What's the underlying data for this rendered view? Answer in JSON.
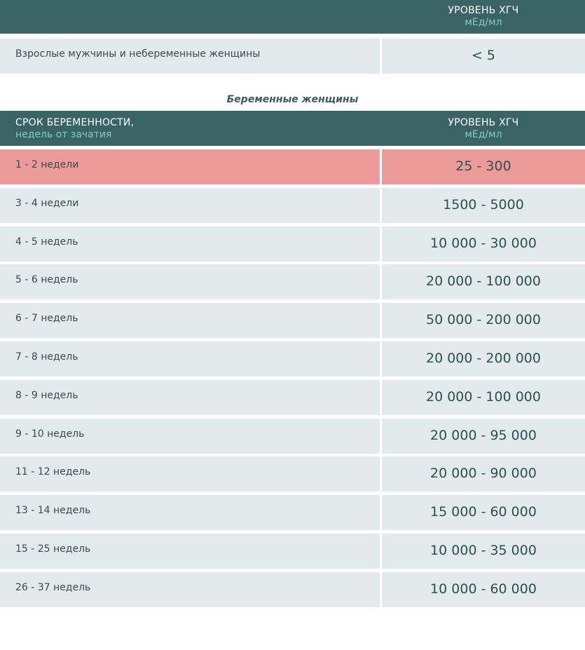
{
  "non_pregnant_table": {
    "header": {
      "level_label": "УРОВЕНЬ ХГЧ",
      "unit_label": "мЕд/мл"
    },
    "row": {
      "group": "Взрослые мужчины и небеременные женщины",
      "value": "< 5"
    }
  },
  "pregnant_table": {
    "caption": "Беременные женщины",
    "header": {
      "term_label": "СРОК БЕРЕМЕННОСТИ,",
      "term_sub_label": "недель от зачатия",
      "level_label": "УРОВЕНЬ ХГЧ",
      "unit_label": "мЕд/мл"
    },
    "rows": [
      {
        "term": "1 - 2 недели",
        "value": "25 - 300",
        "highlighted": true
      },
      {
        "term": "3 - 4 недели",
        "value": "1500 - 5000"
      },
      {
        "term": "4 - 5 недель",
        "value": "10 000 - 30 000"
      },
      {
        "term": "5 - 6 недель",
        "value": "20 000 - 100 000"
      },
      {
        "term": "6 - 7 недель",
        "value": "50 000 - 200 000"
      },
      {
        "term": "7 - 8 недель",
        "value": "20 000 - 200 000"
      },
      {
        "term": "8 - 9 недель",
        "value": "20 000 - 100 000"
      },
      {
        "term": "9 - 10 недель",
        "value": "20 000 - 95 000"
      },
      {
        "term": "11 - 12 недель",
        "value": "20 000 - 90 000"
      },
      {
        "term": "13 - 14 недель",
        "value": "15 000 - 60 000"
      },
      {
        "term": "15 - 25 недель",
        "value": "10 000 - 35 000"
      },
      {
        "term": "26 - 37 недель",
        "value": "10 000 - 60 000"
      }
    ]
  },
  "colors": {
    "header_bg": "#396365",
    "header_sub_text": "#7fcfbf",
    "row_bg": "#e3eaeb",
    "highlight_bg": "#ed9a9b"
  }
}
